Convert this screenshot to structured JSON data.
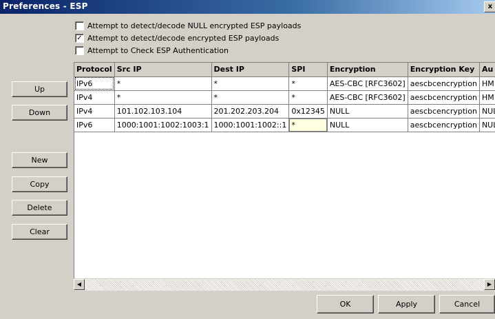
{
  "window": {
    "title": "Preferences - ESP",
    "close_glyph": "x"
  },
  "options": [
    {
      "label": "Attempt to detect/decode NULL encrypted ESP payloads",
      "checked": false
    },
    {
      "label": "Attempt to detect/decode encrypted ESP payloads",
      "checked": true
    },
    {
      "label": "Attempt to Check ESP Authentication",
      "checked": false
    }
  ],
  "buttons": {
    "up": "Up",
    "down": "Down",
    "new": "New",
    "copy": "Copy",
    "delete": "Delete",
    "clear": "Clear"
  },
  "table": {
    "headers": [
      "Protocol",
      "Src IP",
      "Dest IP",
      "SPI",
      "Encryption",
      "Encryption Key",
      "Au"
    ],
    "rows": [
      [
        "IPv6",
        "*",
        "*",
        "*",
        "AES-CBC [RFC3602]",
        "aescbcencryption",
        "HM"
      ],
      [
        "IPv4",
        "*",
        "*",
        "*",
        "AES-CBC [RFC3602]",
        "aescbcencryption",
        "HM"
      ],
      [
        "IPv4",
        "101.102.103.104",
        "201.202.203.204",
        "0x12345",
        "NULL",
        "aescbcencryption",
        "NUL"
      ],
      [
        "IPv6",
        "1000:1001:1002:1003:1",
        "1000:1001:1002::1",
        "*",
        "NULL",
        "aescbcencryption",
        "NUL"
      ]
    ]
  },
  "scrollbar": {
    "left_icon": "scroll-left-arrow",
    "right_icon": "scroll-right-arrow"
  },
  "footer": {
    "ok": "OK",
    "apply": "Apply",
    "cancel": "Cancel"
  }
}
